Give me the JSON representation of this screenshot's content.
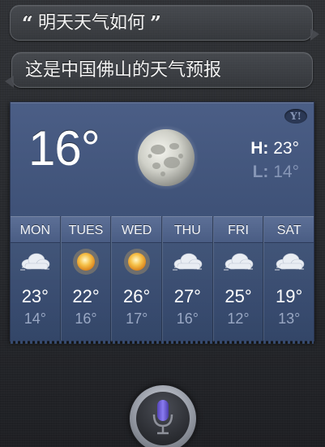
{
  "conversation": {
    "user_query": {
      "open_quote": "“",
      "text": "明天天气如何",
      "close_quote": "”"
    },
    "assistant_reply": "这是中国佛山的天气预报"
  },
  "weather": {
    "current_temp": "16°",
    "condition_icon": "full-moon-icon",
    "high_label": "H:",
    "high_value": "23°",
    "low_label": "L:",
    "low_value": "14°",
    "provider_icon": "yahoo-icon",
    "provider_mark": "Y!",
    "forecast": [
      {
        "day": "MON",
        "icon": "partly-cloudy-night-icon",
        "high": "23°",
        "low": "14°"
      },
      {
        "day": "TUES",
        "icon": "sunny-icon",
        "high": "22°",
        "low": "16°"
      },
      {
        "day": "WED",
        "icon": "sunny-icon",
        "high": "26°",
        "low": "17°"
      },
      {
        "day": "THU",
        "icon": "partly-cloudy-night-icon",
        "high": "27°",
        "low": "16°"
      },
      {
        "day": "FRI",
        "icon": "partly-cloudy-night-icon",
        "high": "25°",
        "low": "12°"
      },
      {
        "day": "SAT",
        "icon": "partly-cloudy-night-icon",
        "high": "19°",
        "low": "13°"
      }
    ]
  },
  "controls": {
    "mic_icon": "microphone-icon",
    "mic_color": "#6f5fd6"
  },
  "colors": {
    "card_background": "#40537a",
    "day_header": "#52658c",
    "low_temp_text": "#9aa8c4"
  }
}
